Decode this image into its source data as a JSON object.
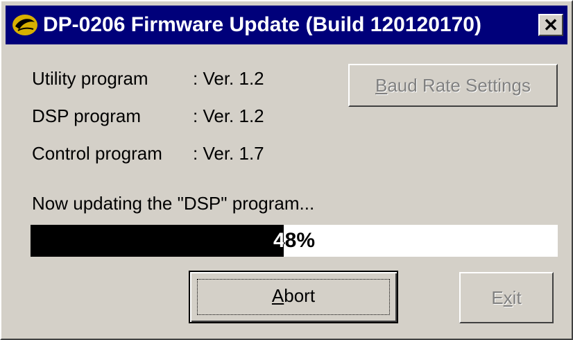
{
  "window": {
    "title": "DP-0206 Firmware Update (Build 120120170)",
    "close_label": "✕",
    "icon": "app-logo-icon"
  },
  "versions": [
    {
      "label": "Utility program",
      "value": ": Ver. 1.2"
    },
    {
      "label": "DSP program",
      "value": ": Ver. 1.2"
    },
    {
      "label": "Control program",
      "value": ": Ver. 1.7"
    }
  ],
  "buttons": {
    "baud": {
      "prefix": "",
      "accel": "B",
      "rest": "aud Rate Settings",
      "enabled": false
    },
    "abort": {
      "prefix": "",
      "accel": "A",
      "rest": "bort",
      "enabled": true
    },
    "exit": {
      "prefix": "E",
      "accel": "x",
      "rest": "it",
      "enabled": false
    }
  },
  "status": {
    "message": "Now updating the \"DSP\" program...",
    "progress_text": "48%",
    "progress_fraction": 0.48
  },
  "colors": {
    "title_bar": "#00007a",
    "progress_fill": "#000000",
    "face": "#d4d0c8"
  }
}
